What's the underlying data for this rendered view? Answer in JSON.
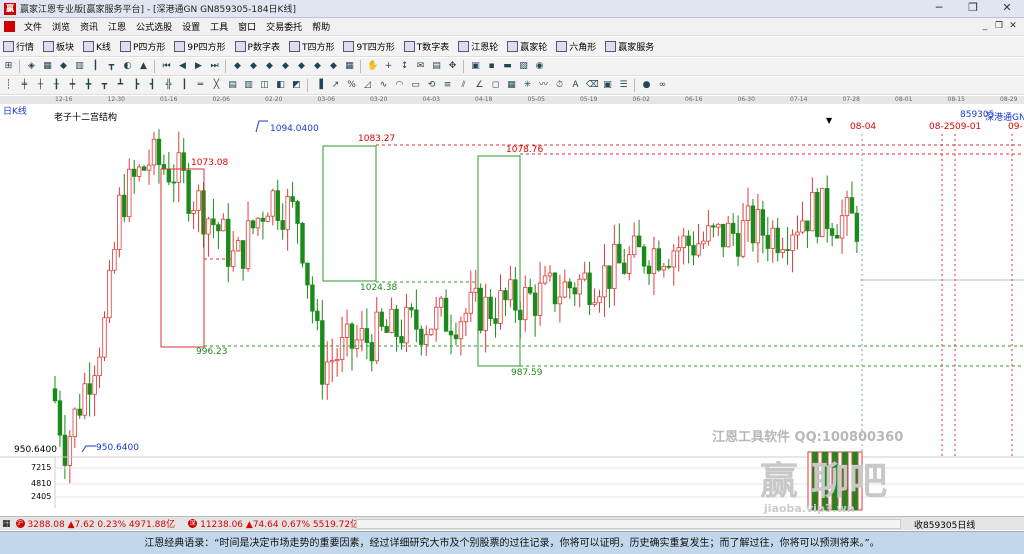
{
  "window": {
    "title": "赢家江恩专业版[赢家服务平台] - [深港通GN  GN859305-184日K线]",
    "buttons": [
      "─",
      "❐",
      "✕"
    ]
  },
  "menu": {
    "items": [
      "文件",
      "浏览",
      "资讯",
      "江恩",
      "公式选股",
      "设置",
      "工具",
      "窗口",
      "交易委托",
      "帮助"
    ],
    "mdi": [
      "_",
      "❐",
      "✕"
    ]
  },
  "toolbar1": {
    "items": [
      {
        "icon": "grid-icon",
        "label": "行情"
      },
      {
        "icon": "blocks-icon",
        "label": "板块"
      },
      {
        "icon": "kline-icon",
        "label": "K线"
      },
      {
        "icon": "p-square-icon",
        "label": "P四方形"
      },
      {
        "icon": "9p-square-icon",
        "label": "9P四方形"
      },
      {
        "icon": "p-number-table-icon",
        "label": "P数字表"
      },
      {
        "icon": "t-square-icon",
        "label": "T四方形"
      },
      {
        "icon": "9t-square-icon",
        "label": "9T四方形"
      },
      {
        "icon": "t-number-table-icon",
        "label": "T数字表"
      },
      {
        "icon": "gann-wheel-icon",
        "label": "江恩轮"
      },
      {
        "icon": "winner-wheel-icon",
        "label": "赢家轮"
      },
      {
        "icon": "hexagon-icon",
        "label": "六角形"
      },
      {
        "icon": "service-icon",
        "label": "赢家服务"
      }
    ]
  },
  "dates": [
    "12-16",
    "12-30",
    "01-16",
    "02-06",
    "02-20",
    "03-06",
    "03-20",
    "04-03",
    "04-18",
    "05-05",
    "05-19",
    "06-02",
    "06-16",
    "06-30",
    "07-14",
    "07-28",
    "08-01",
    "08-15",
    "08-29",
    "09-12"
  ],
  "chart": {
    "period": "日K线",
    "indicator": "老子十二宫结构",
    "code": "859305",
    "name": "深港通GN",
    "low_label": "950.6400",
    "high_label": "1094.0400",
    "vol_ticks": [
      "7215",
      "4810",
      "2405"
    ],
    "watermark1": "江恩工具软件  QQ:100800360",
    "watermark2": "赢   聊吧",
    "watermark3": "jiaoba.vip3.wn",
    "date_labels": [
      "08-04",
      "08-25",
      "09-01",
      "09-"
    ],
    "box_labels": {
      "b1_top": "1073.08",
      "b1_bot": "996.23",
      "b2_top": "1083.27",
      "b2_bot": "1024.38",
      "b3_top": "1078.76",
      "b3_bot": "987.59"
    },
    "colors": {
      "up": "#e23a3a",
      "down": "#1a8a1a",
      "box_red": "#d33",
      "box_green": "#2a9a2a"
    }
  },
  "status": {
    "sh": "3288.08 ▲7.62 0.23% 4971.88亿",
    "sz": "11238.06 ▲74.64 0.67% 5519.72亿",
    "right": "收859305日线"
  },
  "footer": {
    "quote": "江恩经典语录：“时间是决定市场走势的重要因素，经过详细研究大市及个别股票的过往记录，你将可以证明，历史确实重复发生；而了解过往，你将可以预测将来。”。"
  }
}
